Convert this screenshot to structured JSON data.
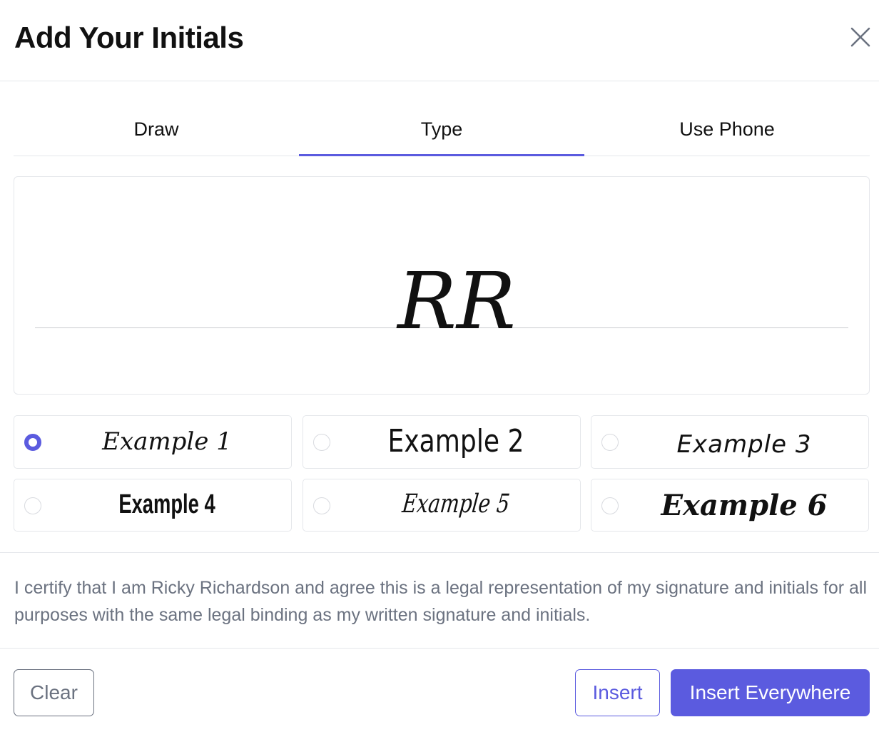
{
  "dialog": {
    "title": "Add Your Initials",
    "close_icon": "close-icon"
  },
  "tabs": [
    {
      "label": "Draw",
      "active": false
    },
    {
      "label": "Type",
      "active": true
    },
    {
      "label": "Use Phone",
      "active": false
    }
  ],
  "preview": {
    "initials": "RR"
  },
  "styles": [
    {
      "label": "Example 1",
      "selected": true
    },
    {
      "label": "Example 2",
      "selected": false
    },
    {
      "label": "Example 3",
      "selected": false
    },
    {
      "label": "Example 4",
      "selected": false
    },
    {
      "label": "Example 5",
      "selected": false
    },
    {
      "label": "Example 6",
      "selected": false
    }
  ],
  "certification": "I certify that I am Ricky Richardson and agree this is a legal representation of my signature and initials for all purposes with the same legal binding as my written signature and initials.",
  "buttons": {
    "clear": "Clear",
    "insert": "Insert",
    "insert_everywhere": "Insert Everywhere"
  },
  "colors": {
    "accent": "#5b5bdf",
    "muted_text": "#6b7280",
    "border": "#e5e7eb"
  }
}
